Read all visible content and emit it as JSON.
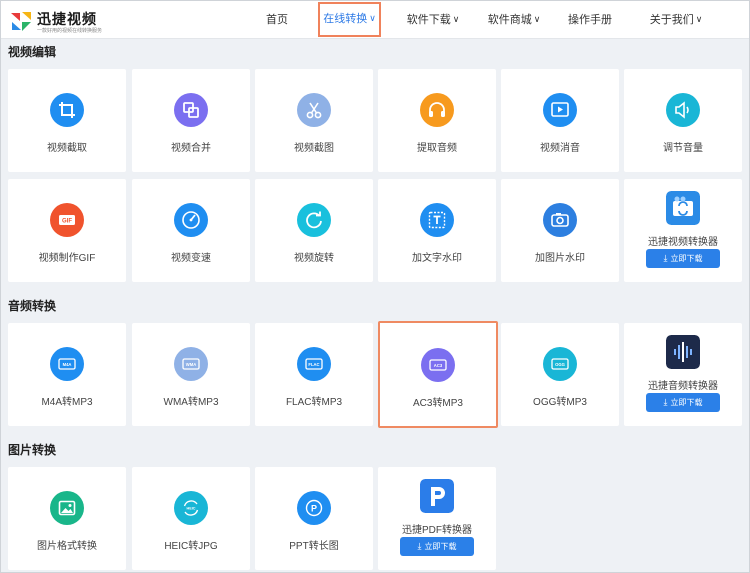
{
  "brand": {
    "name": "迅捷视频",
    "tagline": "一款好用的视频在线转换服务"
  },
  "nav": [
    {
      "label": "首页",
      "has_menu": false
    },
    {
      "label": "在线转换",
      "has_menu": true,
      "active": true
    },
    {
      "label": "软件下载",
      "has_menu": true
    },
    {
      "label": "软件商城",
      "has_menu": true
    },
    {
      "label": "操作手册",
      "has_menu": false
    },
    {
      "label": "关于我们",
      "has_menu": true
    }
  ],
  "nav_chevron": "∨",
  "sections": {
    "video": {
      "title": "视频编辑",
      "items": [
        {
          "label": "视频截取",
          "icon": "crop-icon",
          "color": "#1f8ef1"
        },
        {
          "label": "视频合并",
          "icon": "merge-icon",
          "color": "#7b6ff0"
        },
        {
          "label": "视频截图",
          "icon": "scissors-icon",
          "color": "#8fb1e6"
        },
        {
          "label": "提取音频",
          "icon": "headphones-icon",
          "color": "#f79a1e"
        },
        {
          "label": "视频消音",
          "icon": "play-mute-icon",
          "color": "#1f8ef1"
        },
        {
          "label": "调节音量",
          "icon": "volume-icon",
          "color": "#19b6d6"
        },
        {
          "label": "视频制作GIF",
          "icon": "gif-icon",
          "color": "#f0532d"
        },
        {
          "label": "视频变速",
          "icon": "speed-gauge-icon",
          "color": "#1f8ef1"
        },
        {
          "label": "视频旋转",
          "icon": "rotate-icon",
          "color": "#19c0dd"
        },
        {
          "label": "加文字水印",
          "icon": "text-watermark-icon",
          "color": "#1f8ef1"
        },
        {
          "label": "加图片水印",
          "icon": "image-watermark-icon",
          "color": "#2d7fe0"
        }
      ],
      "promo": {
        "label": "迅捷视频转换器",
        "button": "立即下载",
        "icon": "video-converter-app-icon"
      }
    },
    "audio": {
      "title": "音频转换",
      "items": [
        {
          "label": "M4A转MP3",
          "icon": "m4a-icon",
          "badge": "M4A",
          "color": "#1f8ef1"
        },
        {
          "label": "WMA转MP3",
          "icon": "wma-icon",
          "badge": "WMA",
          "color": "#8fb1e6"
        },
        {
          "label": "FLAC转MP3",
          "icon": "flac-icon",
          "badge": "FLAC",
          "color": "#1f8ef1"
        },
        {
          "label": "AC3转MP3",
          "icon": "ac3-icon",
          "badge": "AC3",
          "color": "#7b6ff0"
        },
        {
          "label": "OGG转MP3",
          "icon": "ogg-icon",
          "badge": "OGG",
          "color": "#19b6d6"
        }
      ],
      "promo": {
        "label": "迅捷音频转换器",
        "button": "立即下载",
        "icon": "audio-converter-app-icon"
      }
    },
    "image": {
      "title": "图片转换",
      "items": [
        {
          "label": "图片格式转换",
          "icon": "image-format-icon",
          "color": "#19b68a"
        },
        {
          "label": "HEIC转JPG",
          "icon": "heic-icon",
          "badge": "HEIC",
          "color": "#19b6d6"
        },
        {
          "label": "PPT转长图",
          "icon": "ppt-icon",
          "badge": "P",
          "color": "#1f8ef1"
        }
      ],
      "promo": {
        "label": "迅捷PDF转换器",
        "button": "立即下载",
        "icon": "pdf-converter-app-icon"
      }
    }
  },
  "download_glyph": "⤓"
}
